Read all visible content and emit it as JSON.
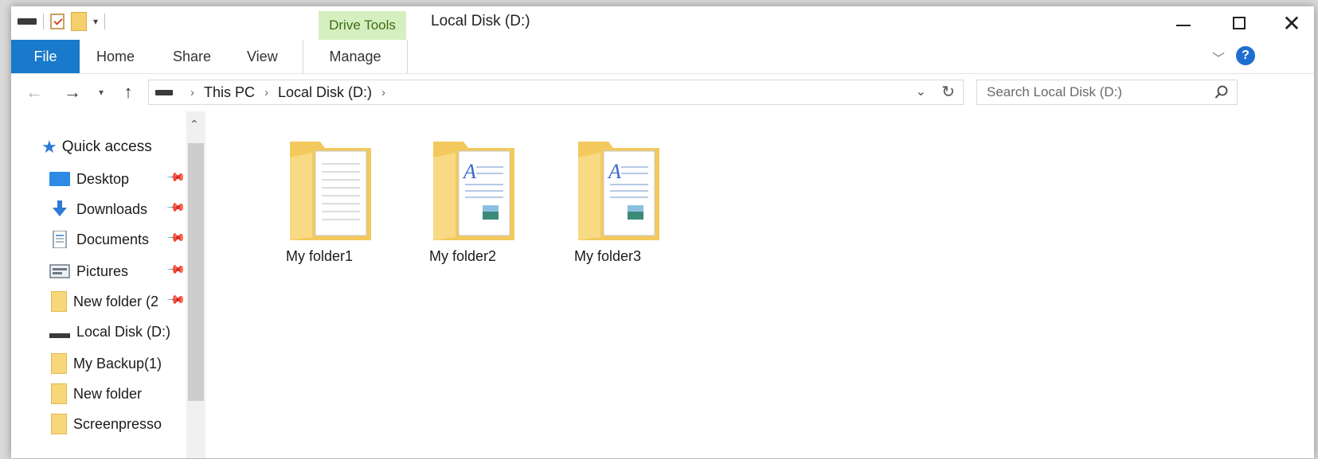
{
  "window": {
    "title": "Local Disk (D:)",
    "contextual_tab": "Drive Tools",
    "controls": {
      "minimize": "minimize",
      "maximize": "maximize",
      "close": "✕"
    }
  },
  "ribbon": {
    "tabs": [
      "File",
      "Home",
      "Share",
      "View",
      "Manage"
    ],
    "active_color": "#1979ca",
    "contextual_color": "#d6efc0"
  },
  "address": {
    "segments": [
      "This PC",
      "Local Disk (D:)"
    ],
    "search_placeholder": "Search Local Disk (D:)"
  },
  "navpane": {
    "quick_access": "Quick access",
    "items": [
      {
        "label": "Desktop",
        "icon": "desktop-icon",
        "pinned": true
      },
      {
        "label": "Downloads",
        "icon": "download-arrow-icon",
        "pinned": true
      },
      {
        "label": "Documents",
        "icon": "documents-icon",
        "pinned": true
      },
      {
        "label": "Pictures",
        "icon": "pictures-icon",
        "pinned": true
      },
      {
        "label": "New folder (2",
        "icon": "folder-icon",
        "pinned": true
      },
      {
        "label": "Local Disk (D:)",
        "icon": "drive-icon",
        "pinned": false
      },
      {
        "label": "My Backup(1)",
        "icon": "folder-icon",
        "pinned": false
      },
      {
        "label": "New folder",
        "icon": "folder-icon",
        "pinned": false
      },
      {
        "label": "Screenpresso",
        "icon": "folder-icon",
        "pinned": false
      }
    ]
  },
  "content": {
    "folders": [
      {
        "name": "My folder1",
        "preview": "blank-page"
      },
      {
        "name": "My folder2",
        "preview": "document-page"
      },
      {
        "name": "My folder3",
        "preview": "document-page"
      }
    ]
  }
}
